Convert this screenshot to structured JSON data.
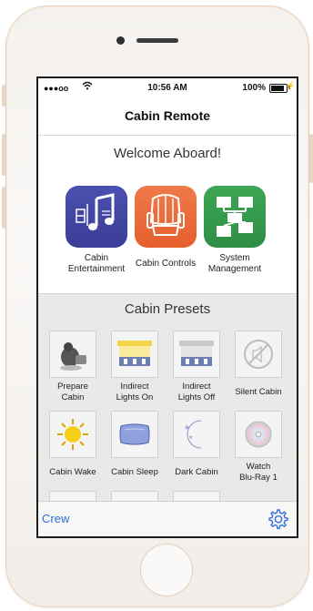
{
  "status_bar": {
    "signal": "●●●oo",
    "wifi_icon": "wifi-icon",
    "time": "10:56 AM",
    "battery_percent": "100%"
  },
  "nav": {
    "title": "Cabin Remote"
  },
  "welcome": "Welcome Aboard!",
  "apps": [
    {
      "label_line1": "Cabin",
      "label_line2": "Entertainment",
      "icon": "music-note-icon",
      "color": "#4147a5"
    },
    {
      "label_line1": "Cabin Controls",
      "label_line2": "",
      "icon": "seat-icon",
      "color": "#ec6b39"
    },
    {
      "label_line1": "System",
      "label_line2": "Management",
      "icon": "network-icon",
      "color": "#36994b"
    }
  ],
  "presets": {
    "title": "Cabin Presets",
    "items": [
      {
        "label_line1": "Prepare",
        "label_line2": "Cabin",
        "icon": "crew-figure-icon"
      },
      {
        "label_line1": "Indirect",
        "label_line2": "Lights On",
        "icon": "lights-on-icon"
      },
      {
        "label_line1": "Indirect",
        "label_line2": "Lights Off",
        "icon": "lights-off-icon"
      },
      {
        "label_line1": "Silent Cabin",
        "label_line2": "",
        "icon": "mute-icon"
      },
      {
        "label_line1": "Cabin Wake",
        "label_line2": "",
        "icon": "sun-icon"
      },
      {
        "label_line1": "Cabin Sleep",
        "label_line2": "",
        "icon": "pillow-icon"
      },
      {
        "label_line1": "Dark Cabin",
        "label_line2": "",
        "icon": "moon-icon"
      },
      {
        "label_line1": "Watch",
        "label_line2": "Blu-Ray 1",
        "icon": "disc-icon"
      }
    ]
  },
  "tab_bar": {
    "crew_label": "Crew",
    "settings_icon": "gear-icon"
  }
}
